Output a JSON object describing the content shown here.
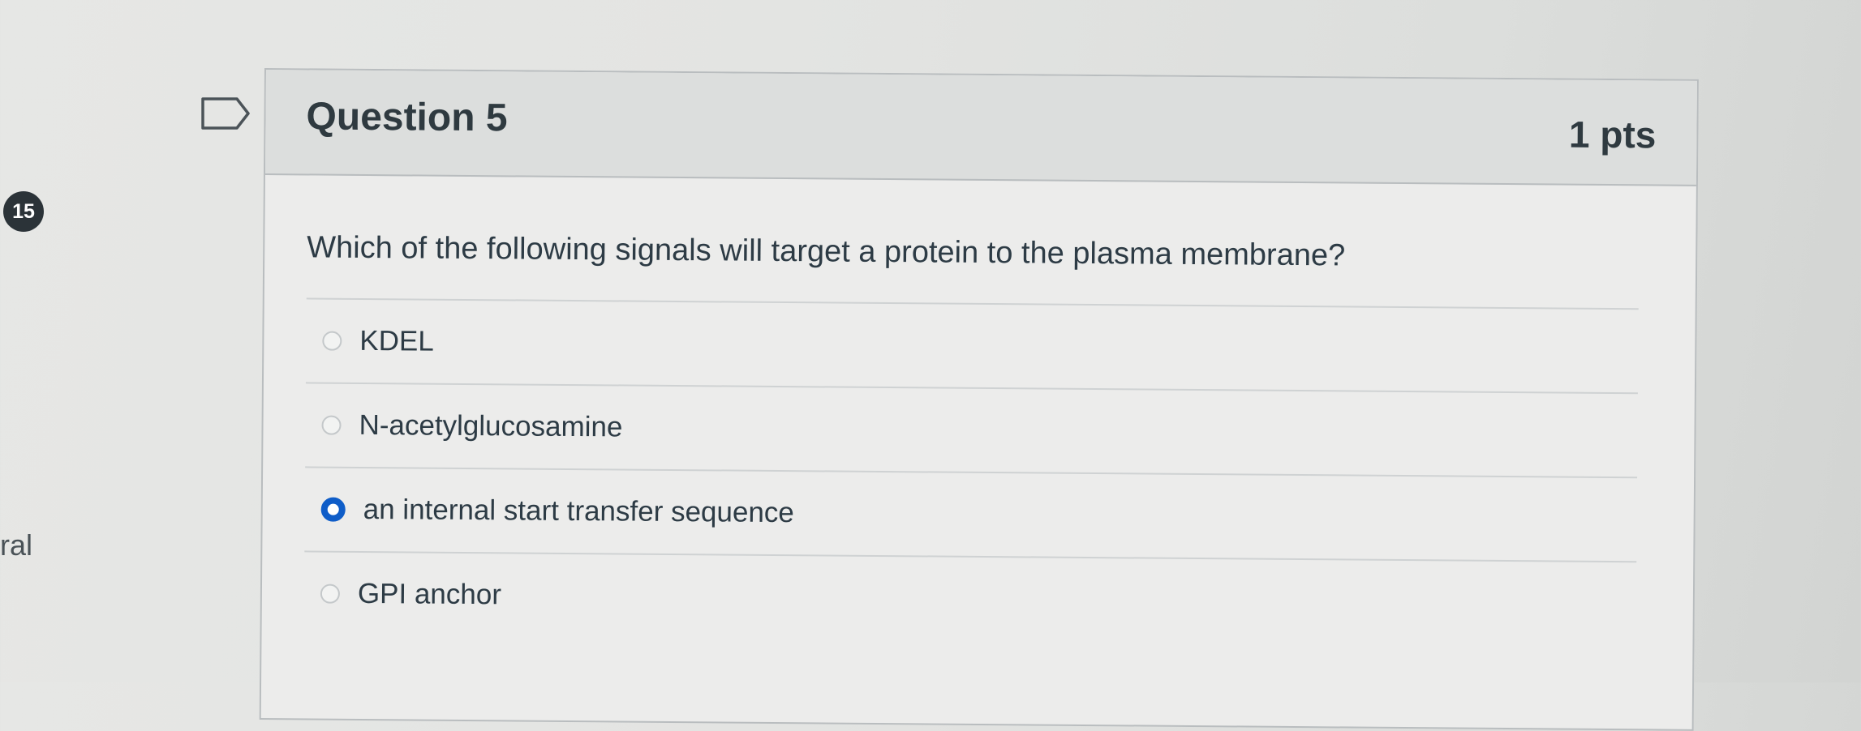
{
  "progress": {
    "badge": "15"
  },
  "side": {
    "partial_text": "ral"
  },
  "question": {
    "title": "Question 5",
    "points": "1 pts",
    "text": "Which of the following signals will target a protein to the plasma membrane?",
    "answers": [
      {
        "label": "KDEL",
        "selected": false
      },
      {
        "label": "N-acetylglucosamine",
        "selected": false
      },
      {
        "label": "an internal start transfer sequence",
        "selected": true
      },
      {
        "label": "GPI anchor",
        "selected": false
      }
    ]
  },
  "icons": {
    "flag": "flag-icon",
    "radio_empty": "radio-unselected",
    "radio_selected": "radio-selected"
  },
  "colors": {
    "accent": "#0f5dc8",
    "badge": "#2b3338",
    "text": "#2d3b45"
  }
}
